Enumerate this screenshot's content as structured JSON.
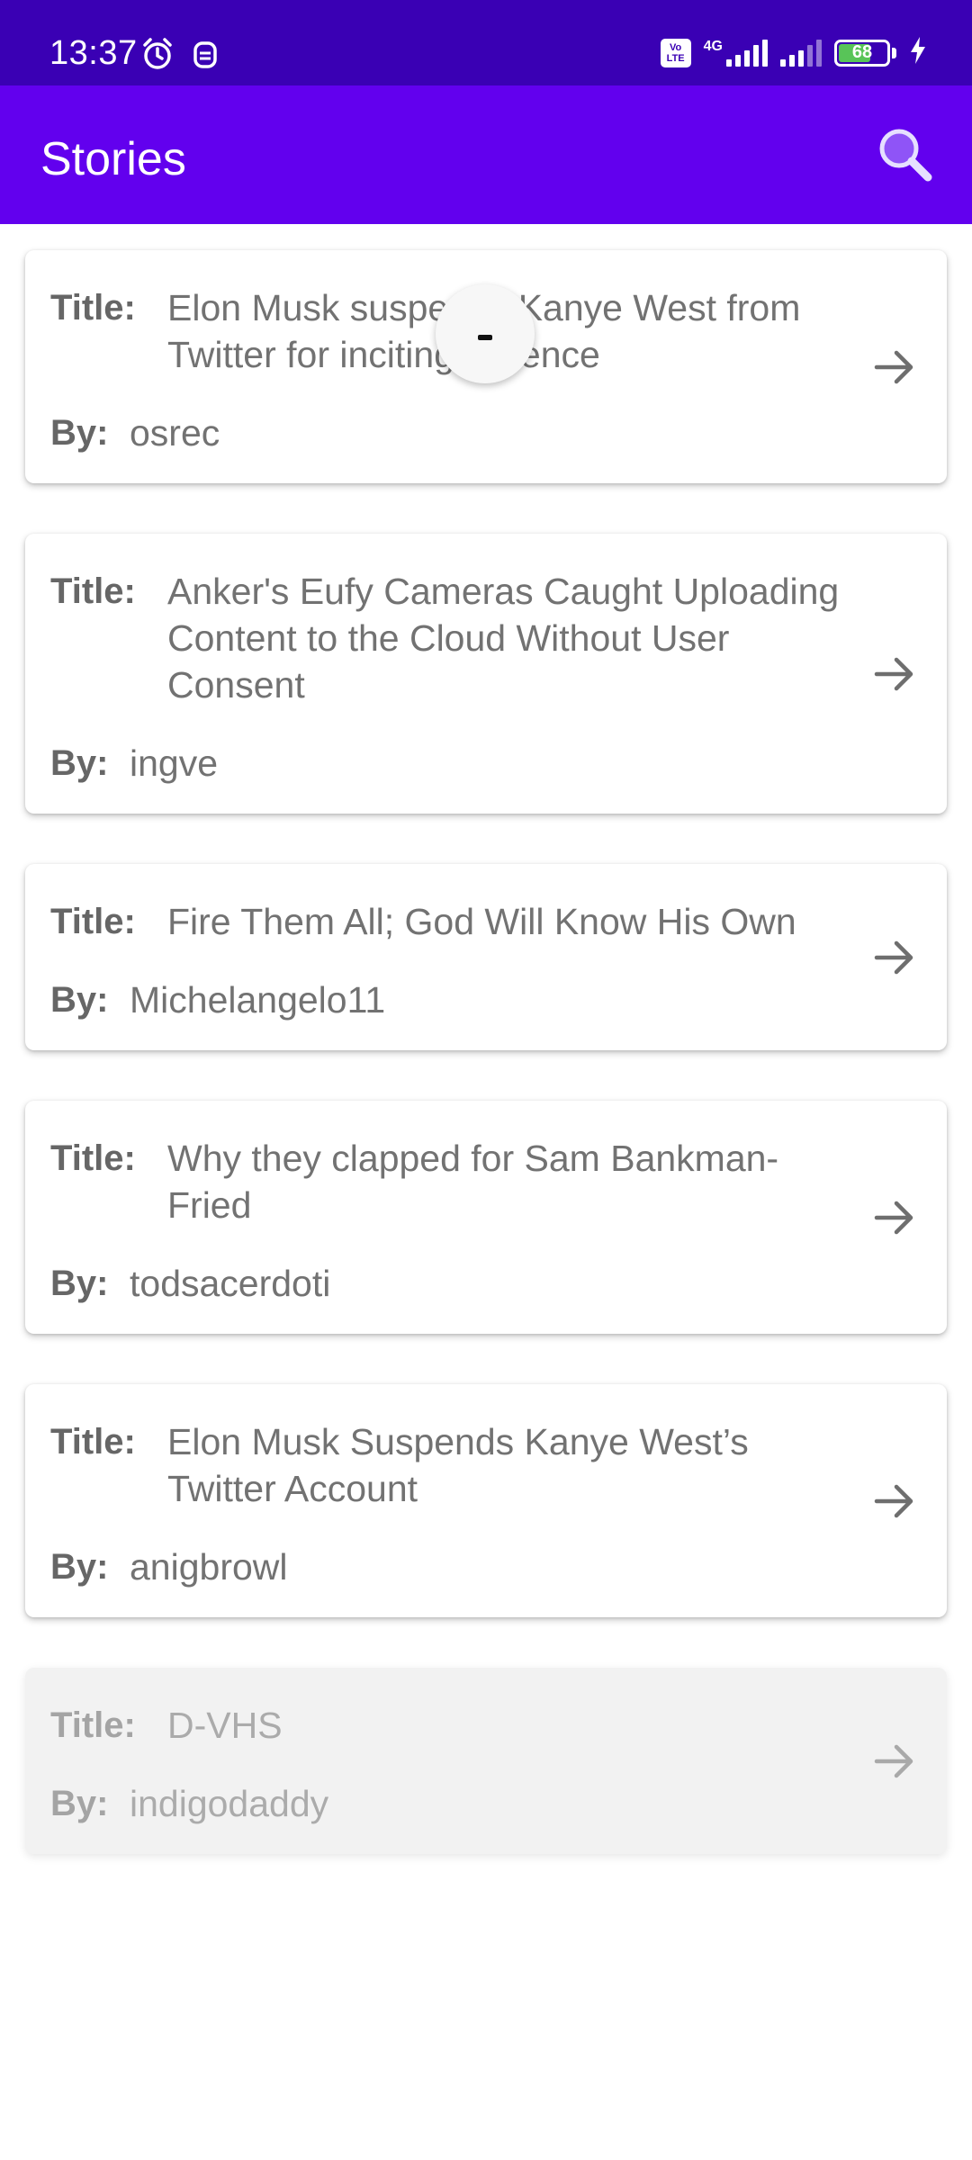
{
  "status_bar": {
    "time": "13:37",
    "icons_left": [
      "alarm-icon",
      "notification-app-icon"
    ],
    "volte_label_top": "Vo",
    "volte_label_bottom": "LTE",
    "network_type": "4G",
    "battery_level": "68",
    "battery_level_fraction": 0.68,
    "charging": true
  },
  "app_bar": {
    "title": "Stories",
    "search_icon": "search-icon",
    "color": "#6200ee"
  },
  "labels": {
    "title": "Title:",
    "by": "By:"
  },
  "stories": [
    {
      "title": "Elon Musk suspends Kanye West from Twitter for inciting violence",
      "by": "osrec"
    },
    {
      "title": "Anker's Eufy Cameras Caught Uploading Content to the Cloud Without User Consent",
      "by": "ingve"
    },
    {
      "title": "Fire Them All; God Will Know His Own",
      "by": "Michelangelo11"
    },
    {
      "title": "Why they clapped for Sam Bankman-Fried",
      "by": "todsacerdoti"
    },
    {
      "title": "Elon Musk Suspends Kanye West’s Twitter Account",
      "by": "anigbrowl"
    },
    {
      "title": "D-VHS",
      "by": "indigodaddy"
    }
  ],
  "loading_indicator": true
}
